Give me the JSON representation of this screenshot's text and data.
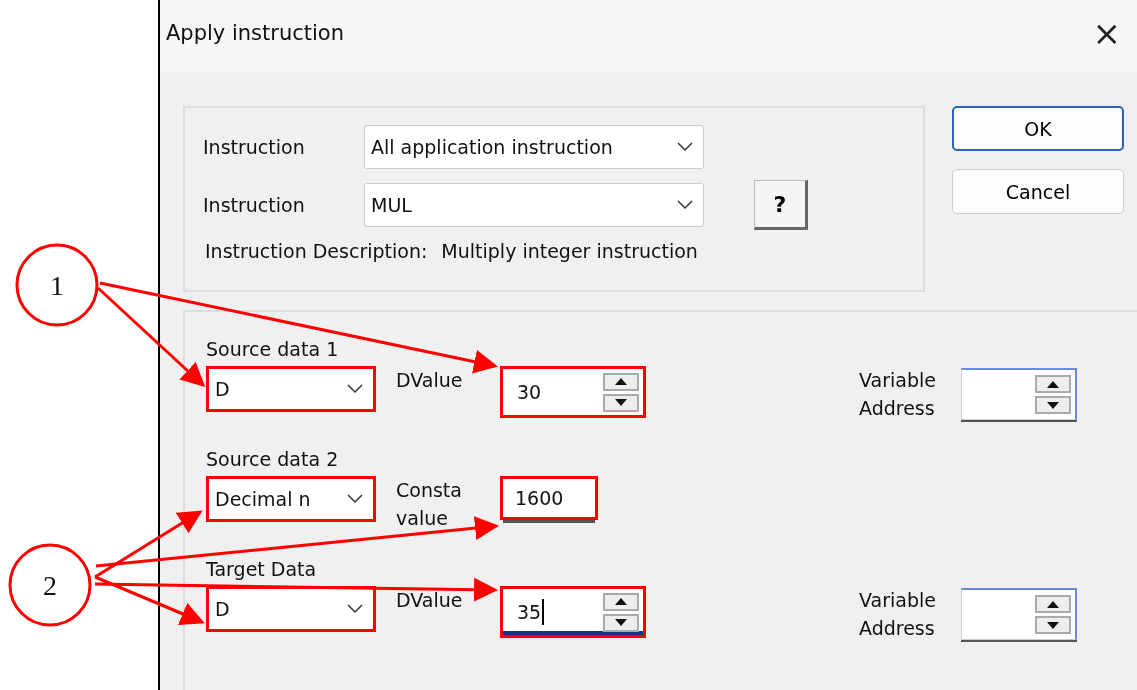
{
  "window": {
    "title": "Apply instruction",
    "close": "×"
  },
  "instruction_box": {
    "rows": [
      {
        "label": "Instruction",
        "value": "All application instruction"
      },
      {
        "label": "Instruction",
        "value": "MUL"
      }
    ],
    "help": "?",
    "description_label": "Instruction Description:",
    "description": "Multiply integer instruction"
  },
  "buttons": [
    {
      "label": "OK",
      "default": true
    },
    {
      "label": "Cancel",
      "default": false
    }
  ],
  "operands": [
    {
      "title": "Source data 1",
      "type": {
        "value": "D",
        "highlighted": true
      },
      "value_label": "DValue",
      "value": {
        "kind": "spin",
        "value": "30",
        "highlighted": true,
        "focused": false
      },
      "address_label": "Variable Address"
    },
    {
      "title": "Source data 2",
      "type": {
        "value": "Decimal n",
        "highlighted": true
      },
      "value_label": "Consta value",
      "value": {
        "kind": "plain",
        "value": "1600",
        "highlighted": true,
        "focused": false
      }
    },
    {
      "title": "Target Data",
      "type": {
        "value": "D",
        "highlighted": true
      },
      "value_label": "DValue",
      "value": {
        "kind": "spin",
        "value": "35",
        "highlighted": true,
        "focused": true
      },
      "address_label": "Variable Address"
    }
  ],
  "callouts": [
    {
      "label": "1"
    },
    {
      "label": "2"
    }
  ]
}
